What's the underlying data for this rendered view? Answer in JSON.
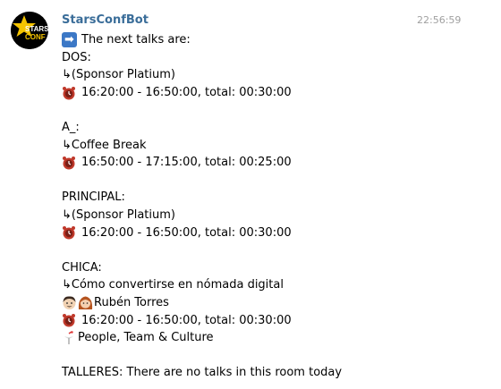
{
  "message": {
    "sender": "StarsConfBot",
    "time": "22:56:59",
    "avatar_text": [
      "STARS",
      "CONF"
    ],
    "intro_icon": "right-arrow-emoji-icon",
    "intro": "The next talks are:",
    "rooms": [
      {
        "name": "DOS:",
        "talk": "(Sponsor Platium)",
        "schedule": "16:20:00 - 16:50:00, total: 00:30:00"
      },
      {
        "name": "A_:",
        "talk": "Coffee Break",
        "schedule": "16:50:00 - 17:15:00, total: 00:25:00"
      },
      {
        "name": "PRINCIPAL:",
        "talk": "(Sponsor Platium)",
        "schedule": "16:20:00 - 16:50:00, total: 00:30:00"
      },
      {
        "name": "CHICA:",
        "talk": "Cómo convertirse en nómada digital",
        "speaker": "Rubén Torres",
        "schedule": "16:20:00 - 16:50:00, total: 00:30:00",
        "track": "People, Team & Culture"
      }
    ],
    "no_talks": "TALLERES: There are no talks in this room today",
    "hook_symbol": "↳",
    "colors": {
      "sender": "#3a6d99",
      "time": "#a0a0a0",
      "alarm": "#c0392b",
      "arrow": "#3c78c6"
    }
  }
}
